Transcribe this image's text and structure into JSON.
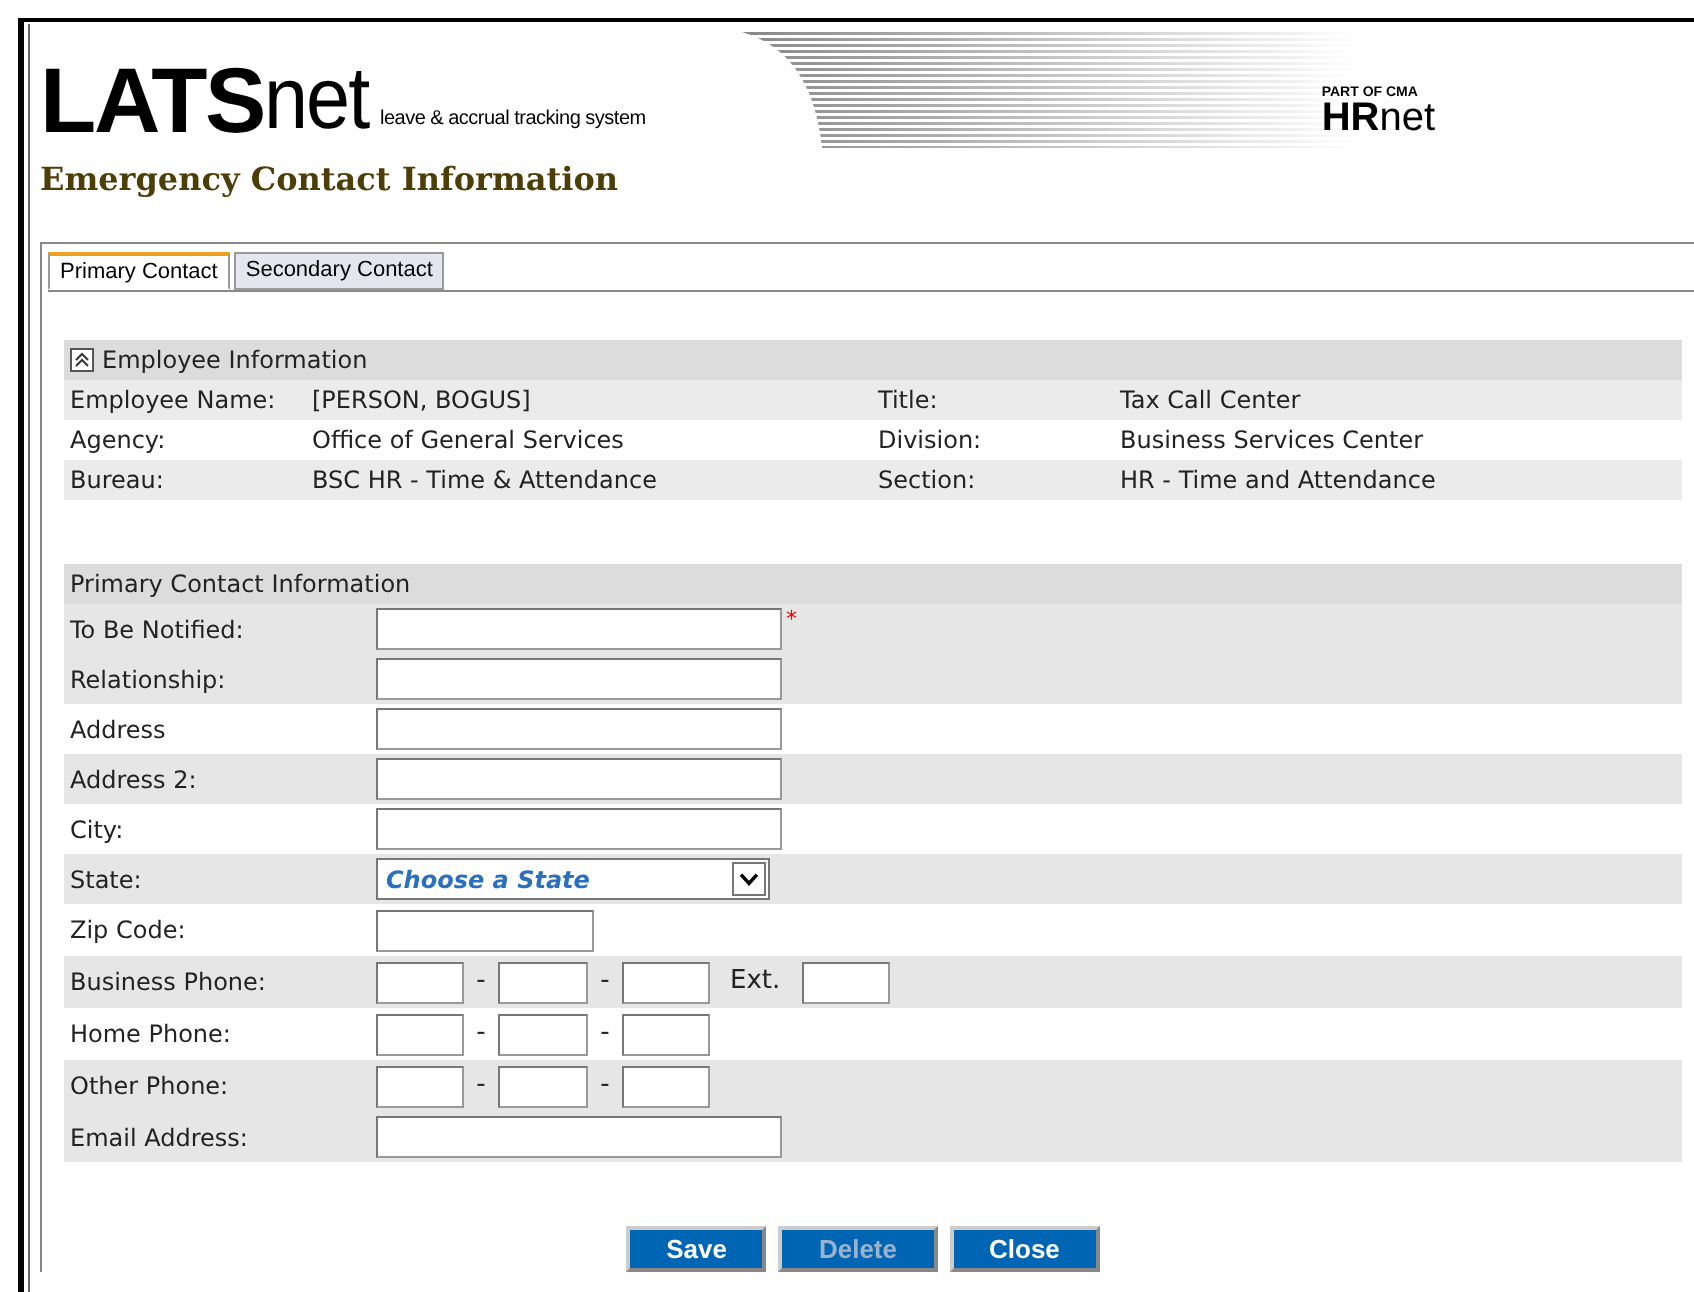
{
  "header": {
    "logo_main": "LATS",
    "logo_suffix": "net",
    "tagline": "leave & accrual tracking system",
    "partner_small": "PART OF CMA",
    "partner_main": "HR",
    "partner_suffix": "net"
  },
  "page_title": "Emergency Contact Information",
  "tabs": [
    {
      "label": "Primary Contact",
      "selected": true
    },
    {
      "label": "Secondary Contact",
      "selected": false
    }
  ],
  "employee_section": {
    "title": "Employee Information",
    "expanded": true,
    "rows": [
      {
        "shaded": true,
        "cells": [
          "Employee Name:",
          "[PERSON, BOGUS]",
          "Title:",
          "Tax Call Center"
        ]
      },
      {
        "shaded": false,
        "cells": [
          "Agency:",
          "Office of General Services",
          "Division:",
          "Business Services Center"
        ]
      },
      {
        "shaded": true,
        "cells": [
          "Bureau:",
          "BSC HR - Time & Attendance",
          "Section:",
          "HR - Time and Attendance"
        ]
      }
    ]
  },
  "contact_section": {
    "title": "Primary Contact Information",
    "fields": [
      {
        "label": "To Be Notified:",
        "kind": "text",
        "required_marker": "*",
        "shaded": true
      },
      {
        "label": "Relationship:",
        "kind": "text",
        "shaded": true
      },
      {
        "label": "Address",
        "kind": "text",
        "shaded": false
      },
      {
        "label": "Address 2:",
        "kind": "text",
        "shaded": true
      },
      {
        "label": "City:",
        "kind": "text",
        "shaded": false
      },
      {
        "label": "State:",
        "kind": "select",
        "value": "Choose a State",
        "shaded": true
      },
      {
        "label": "Zip Code:",
        "kind": "short",
        "shaded": false
      },
      {
        "label": "Business Phone:",
        "kind": "phone",
        "separators": [
          "-",
          "-"
        ],
        "ext_label": "Ext.",
        "shaded": true
      },
      {
        "label": "Home Phone:",
        "kind": "phone",
        "separators": [
          "-",
          "-"
        ],
        "shaded": false
      },
      {
        "label": "Other Phone:",
        "kind": "phone",
        "separators": [
          "-",
          "-"
        ],
        "shaded": true
      },
      {
        "label": "Email Address:",
        "kind": "text",
        "shaded": true
      }
    ]
  },
  "buttons": [
    {
      "label": "Save",
      "disabled": false
    },
    {
      "label": "Delete",
      "disabled": true
    },
    {
      "label": "Close",
      "disabled": false
    }
  ]
}
